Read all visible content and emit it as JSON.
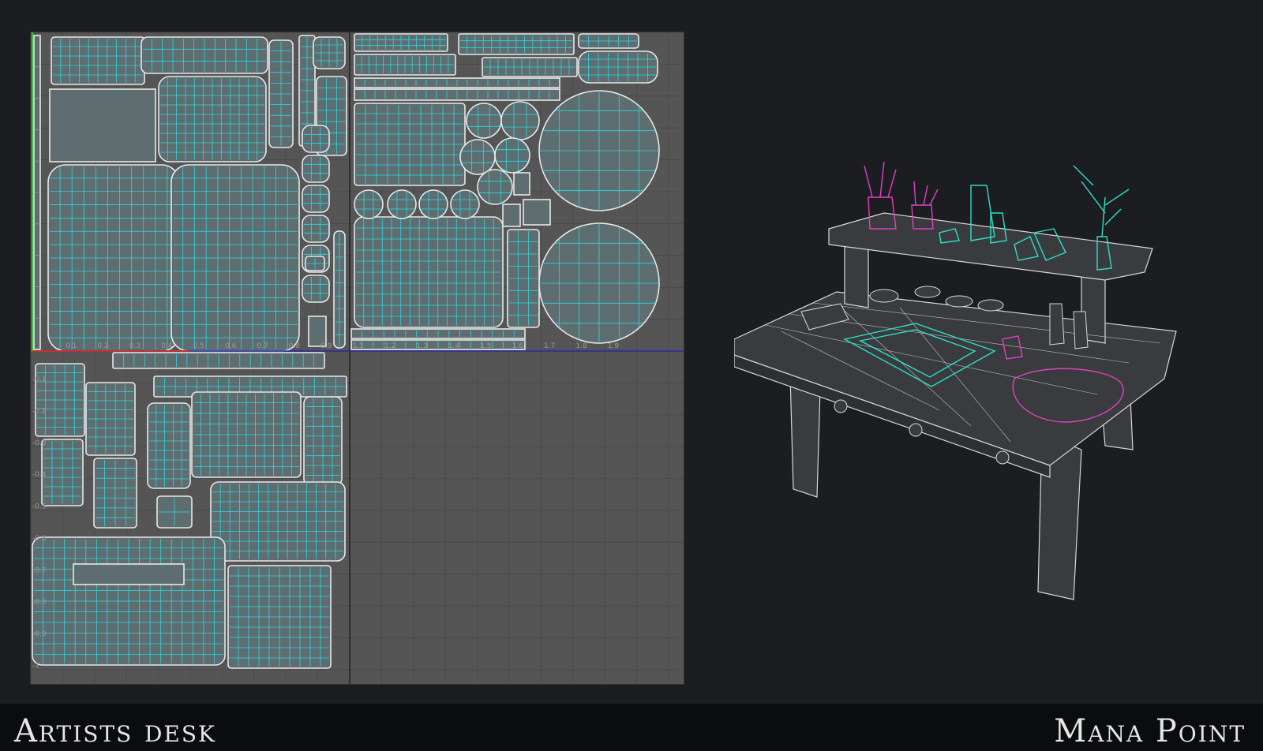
{
  "footer": {
    "left_title": "Artists desk",
    "right_title": "Mana Point"
  },
  "uv_editor": {
    "u_tick_labels": [
      "0.1",
      "0.2",
      "0.3",
      "0.4",
      "0.5",
      "0.6",
      "0.7",
      "0.8",
      "0.9",
      "1.1",
      "1.2",
      "1.3",
      "1.4",
      "1.5",
      "1.6",
      "1.7",
      "1.8",
      "1.9"
    ],
    "v_tick_labels": [
      "-0.1",
      "-0.2",
      "-0.3",
      "-0.4",
      "-0.5",
      "-0.6",
      "-0.7",
      "-0.8",
      "-0.9",
      "-1"
    ]
  },
  "colors": {
    "background": "#1c1d21",
    "footer": "#0b0c0e",
    "uv_grid": "#555555",
    "uv_shell_fill": "#5d6d70",
    "uv_edge": "#2ed8e0",
    "uv_border": "#e8e8e8",
    "wire_white": "#d8d8d8",
    "wire_cyan": "#2be0c8",
    "wire_magenta": "#e040c0"
  }
}
